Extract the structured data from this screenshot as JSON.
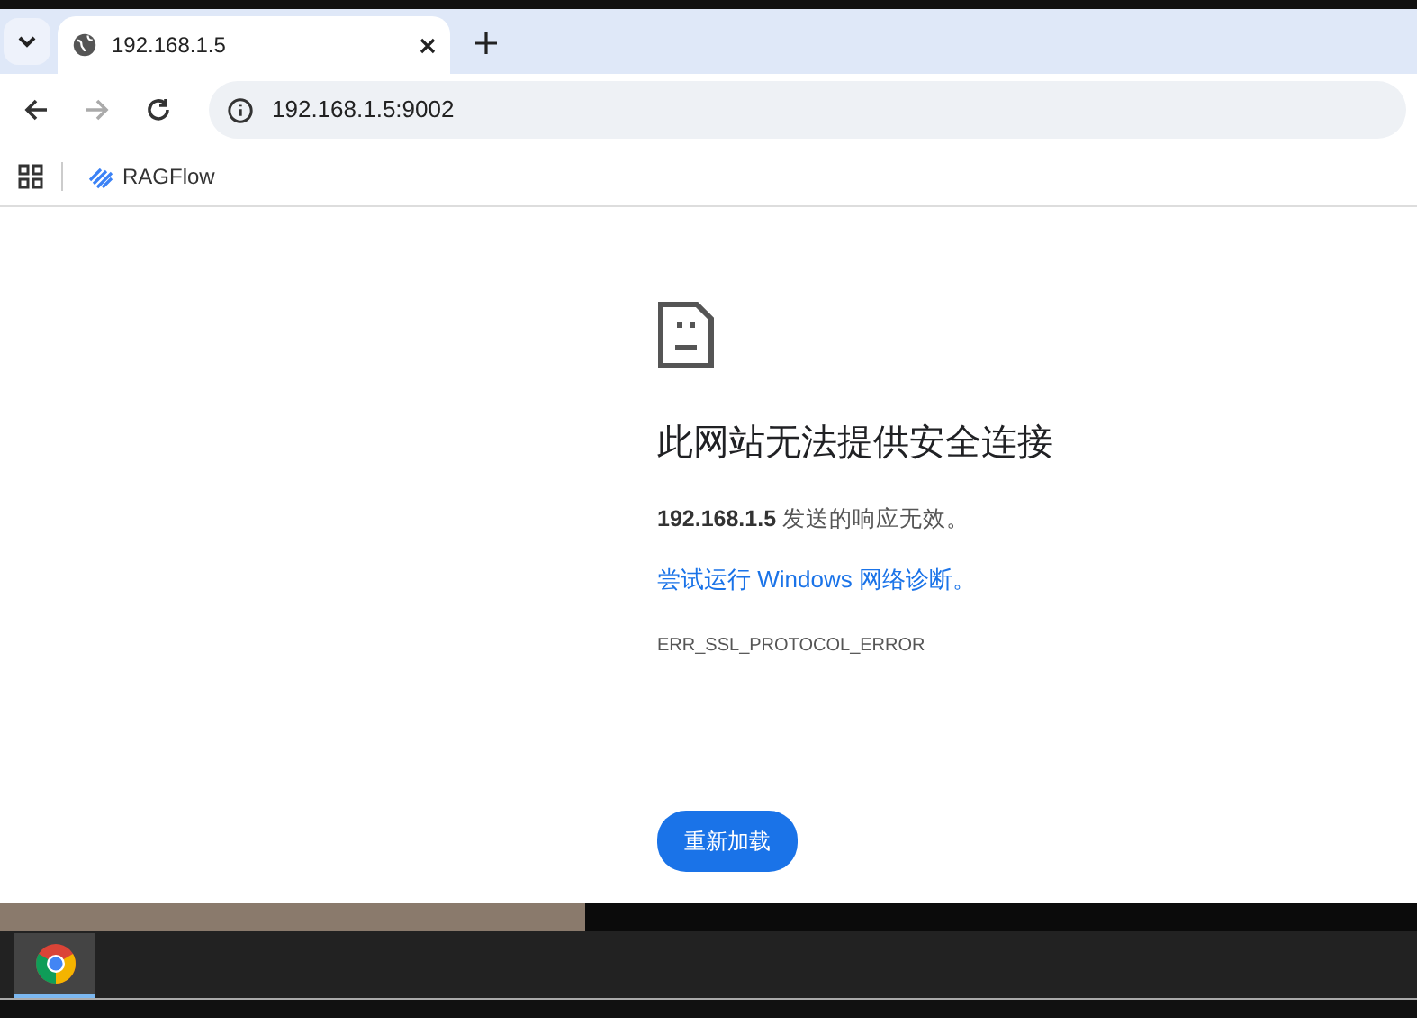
{
  "tabs": [
    {
      "title": "192.168.1.5",
      "selected": true
    }
  ],
  "address_bar": {
    "url": "192.168.1.5:9002"
  },
  "bookmarks": [
    {
      "label": "RAGFlow"
    }
  ],
  "error_page": {
    "heading": "此网站无法提供安全连接",
    "message": "**192.168.1.5** 发送的响应无效。",
    "link": "尝试运行 Windows 网络诊断。",
    "error_code": "ERR_SSL_PROTOCOL_ERROR",
    "button": "重新加载"
  },
  "taskbar": {
    "apps": [
      {
        "kind": "browser",
        "selected": true
      }
    ]
  }
}
